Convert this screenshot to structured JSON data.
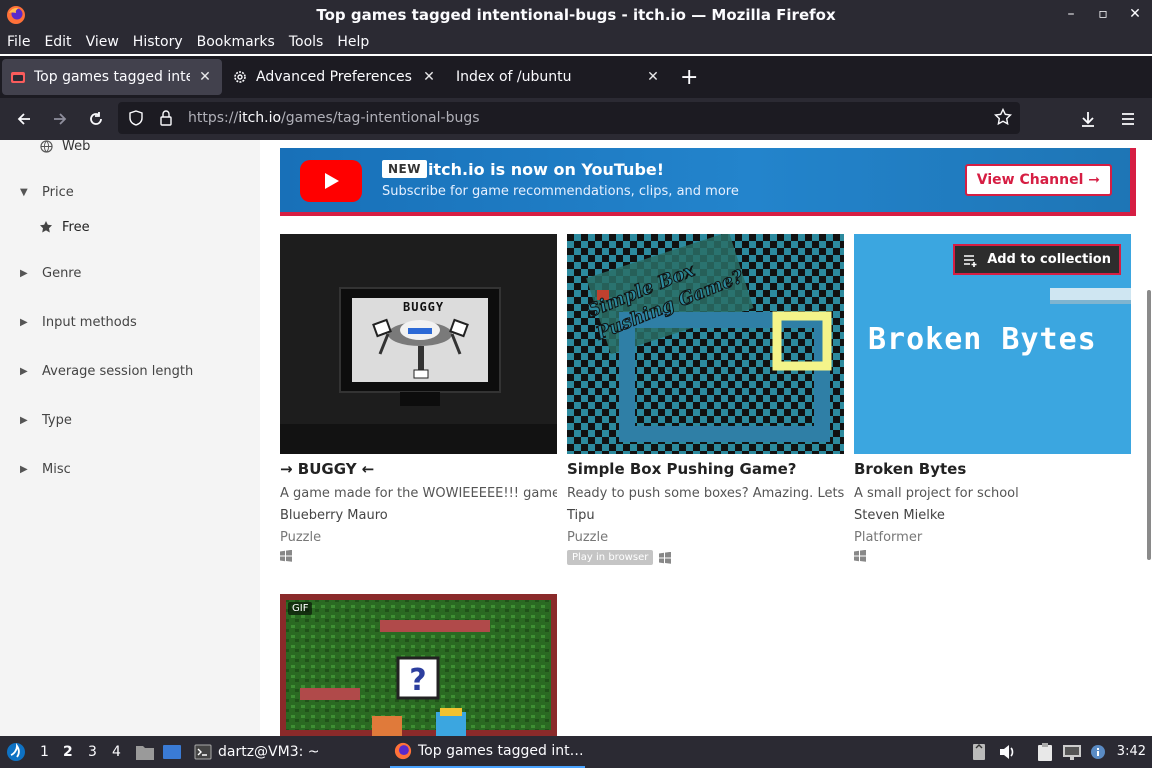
{
  "window": {
    "title": "Top games tagged intentional-bugs - itch.io — Mozilla Firefox",
    "controls": [
      "–",
      "▫",
      "✕"
    ]
  },
  "menu": [
    "File",
    "Edit",
    "View",
    "History",
    "Bookmarks",
    "Tools",
    "Help"
  ],
  "tabs": [
    {
      "label": "Top games tagged intent",
      "icon": "itchio-icon",
      "active": true
    },
    {
      "label": "Advanced Preferences",
      "icon": "gear-icon",
      "active": false
    },
    {
      "label": "Index of /ubuntu",
      "icon": "",
      "active": false
    }
  ],
  "urlbar": {
    "prefix": "https://",
    "host": "itch.io",
    "path": "/games/tag-intentional-bugs"
  },
  "sidebar": {
    "web_label": "Web",
    "price_label": "Price",
    "free_label": "Free",
    "genre_label": "Genre",
    "input_label": "Input methods",
    "session_label": "Average session length",
    "type_label": "Type",
    "misc_label": "Misc"
  },
  "banner": {
    "new_tag": "NEW",
    "headline": "itch.io is now on YouTube!",
    "sub": "Subscribe for game recommendations, clips, and more",
    "button": "View Channel ➞"
  },
  "games": [
    {
      "title": "→ BUGGY ←",
      "thumb_text": "BUGGY",
      "desc": "A game made for the WOWIEEEEE!!! game ...",
      "author": "Blueberry Mauro",
      "genre": "Puzzle",
      "play_in_browser": ""
    },
    {
      "title": "Simple Box Pushing Game?",
      "thumb_text": "Simple Box Pushing Game?",
      "desc": "Ready to push some boxes? Amazing. Lets ju...",
      "author": "Tipu",
      "genre": "Puzzle",
      "play_in_browser": "Play in browser"
    },
    {
      "title": "Broken Bytes",
      "thumb_text": "Broken Bytes",
      "desc": "A small project for school",
      "author": "Steven Mielke",
      "genre": "Platformer",
      "play_in_browser": ""
    }
  ],
  "add_collection": "Add to collection",
  "gif_badge": "GIF",
  "taskbar": {
    "workspaces": [
      "1",
      "2",
      "3",
      "4"
    ],
    "terminal": "dartz@VM3: ~",
    "firefox_task": "Top games tagged int…",
    "clock": "3:42"
  }
}
